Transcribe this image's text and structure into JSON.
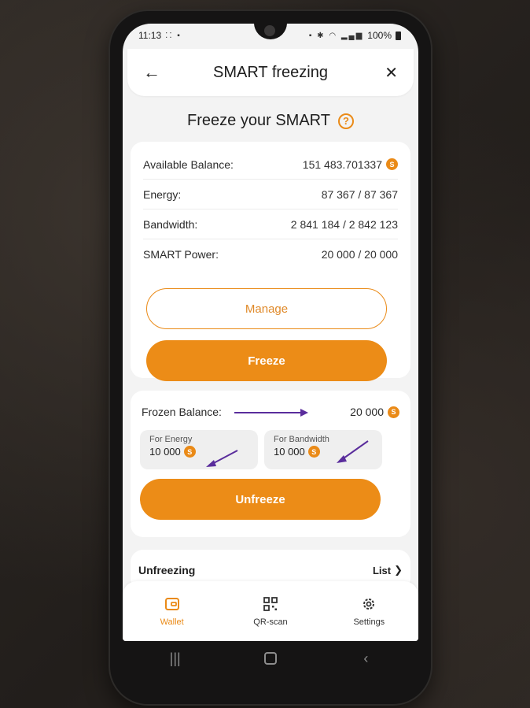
{
  "status_bar": {
    "time": "11:13",
    "battery": "100%"
  },
  "header": {
    "title": "SMART freezing"
  },
  "headline": {
    "text": "Freeze your SMART",
    "help_symbol": "?"
  },
  "coin_symbol": "S",
  "balance": {
    "rows": [
      {
        "label": "Available Balance:",
        "value": "151 483.701337",
        "has_coin": true
      },
      {
        "label": "Energy:",
        "value": "87 367 / 87 367",
        "has_coin": false
      },
      {
        "label": "Bandwidth:",
        "value": "2 841 184 / 2 842 123",
        "has_coin": false
      },
      {
        "label": "SMART Power:",
        "value": "20 000 / 20 000",
        "has_coin": false
      }
    ],
    "manage_label": "Manage",
    "freeze_label": "Freeze"
  },
  "frozen": {
    "label": "Frozen Balance:",
    "value": "20 000",
    "energy_label": "For Energy",
    "energy_value": "10 000",
    "bandwidth_label": "For Bandwidth",
    "bandwidth_value": "10 000",
    "unfreeze_label": "Unfreeze"
  },
  "unfreezing": {
    "title": "Unfreezing",
    "list_label": "List"
  },
  "tabs": [
    {
      "label": "Wallet",
      "icon": "wallet-icon",
      "active": true
    },
    {
      "label": "QR-scan",
      "icon": "qr-icon",
      "active": false
    },
    {
      "label": "Settings",
      "icon": "gear-icon",
      "active": false
    }
  ],
  "colors": {
    "accent": "#ec8c17",
    "annotation_arrow": "#5a2d9c"
  }
}
